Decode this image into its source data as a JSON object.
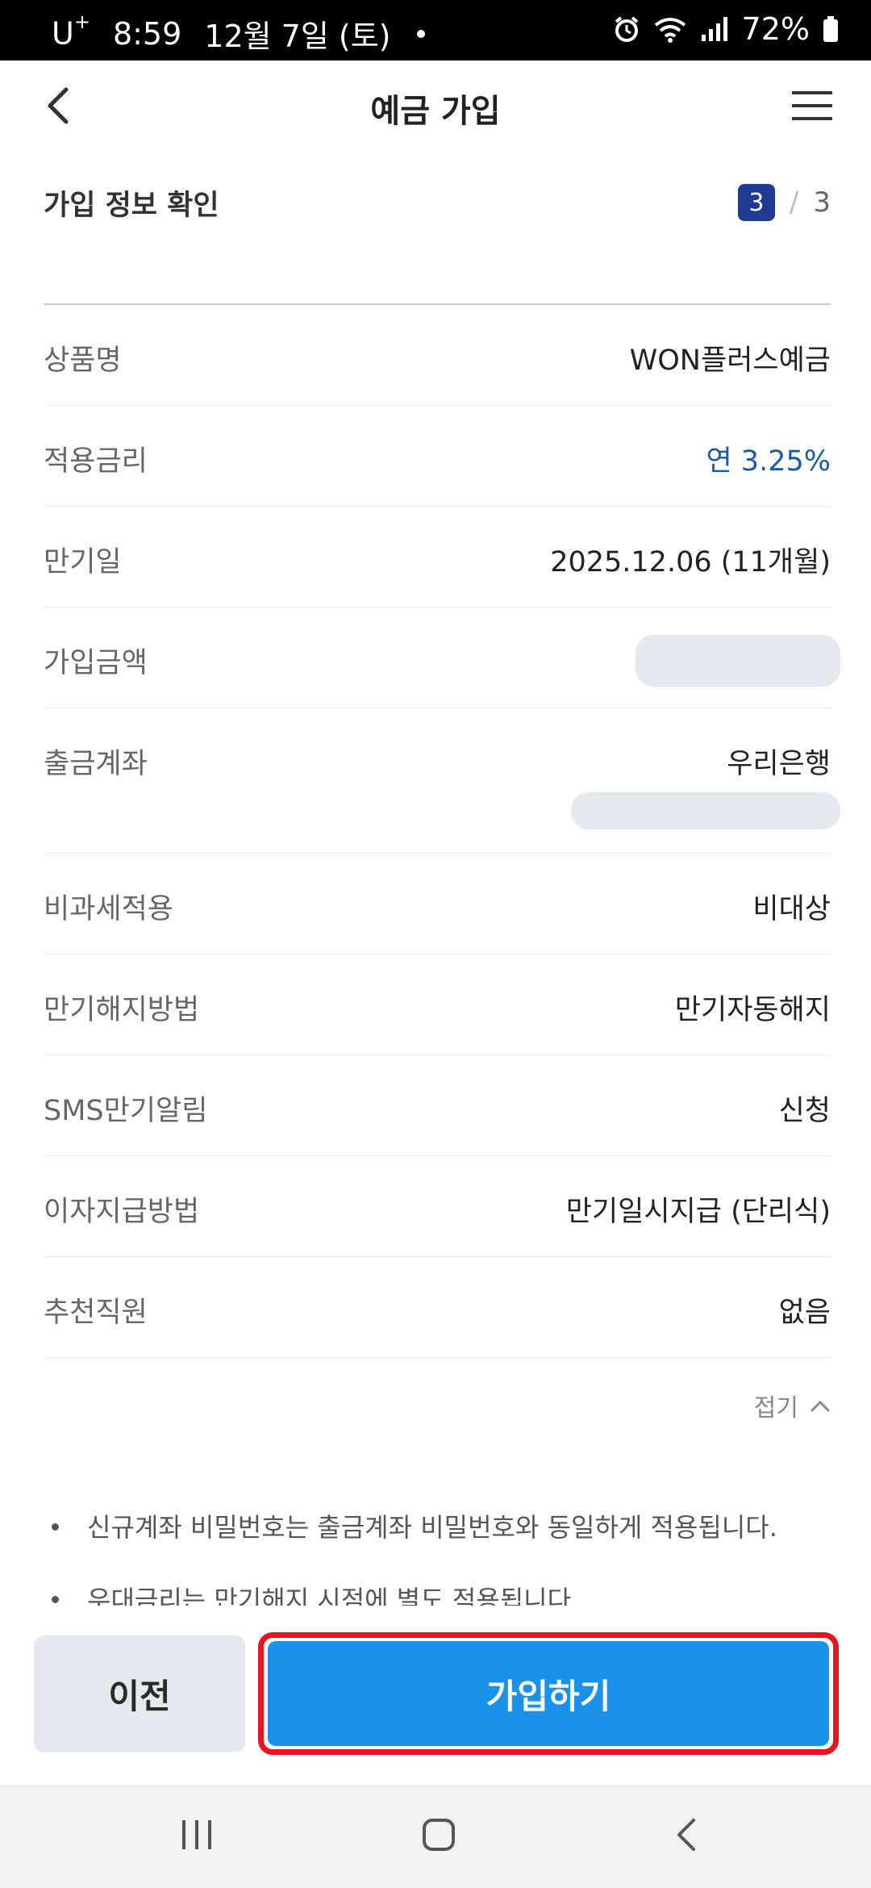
{
  "status_bar": {
    "carrier": "U",
    "carrier_sup": "+",
    "time": "8:59",
    "date": "12월 7일 (토)",
    "battery": "72%"
  },
  "header": {
    "title": "예금 가입",
    "back_icon": "back-arrow-icon",
    "menu_icon": "hamburger-menu-icon"
  },
  "step": {
    "title": "가입 정보 확인",
    "current": "3",
    "separator": "/",
    "total": "3"
  },
  "rows": [
    {
      "label": "상품명",
      "value": "WON플러스예금"
    },
    {
      "label": "적용금리",
      "value": "연 3.25%"
    },
    {
      "label": "만기일",
      "value": "2025.12.06 (11개월)"
    },
    {
      "label": "가입금액",
      "value": ""
    },
    {
      "label": "출금계좌",
      "value": "우리은행"
    },
    {
      "label": "비과세적용",
      "value": "비대상"
    },
    {
      "label": "만기해지방법",
      "value": "만기자동해지"
    },
    {
      "label": "SMS만기알림",
      "value": "신청"
    },
    {
      "label": "이자지급방법",
      "value": "만기일시지급 (단리식)"
    },
    {
      "label": "추천직원",
      "value": "없음"
    }
  ],
  "fold_label": "접기",
  "notes": [
    "신규계좌 비밀번호는 출금계좌 비밀번호와 동일하게 적용됩니다.",
    "우대금리는 만기해지 시점에 별도 적용됩니다."
  ],
  "buttons": {
    "prev": "이전",
    "join": "가입하기"
  },
  "colors": {
    "accent": "#1a91ea",
    "highlight_border": "#e51620",
    "rate_text": "#1b5aa8",
    "step_badge": "#1f3a93",
    "masked_placeholder": "#e4e9f0"
  }
}
